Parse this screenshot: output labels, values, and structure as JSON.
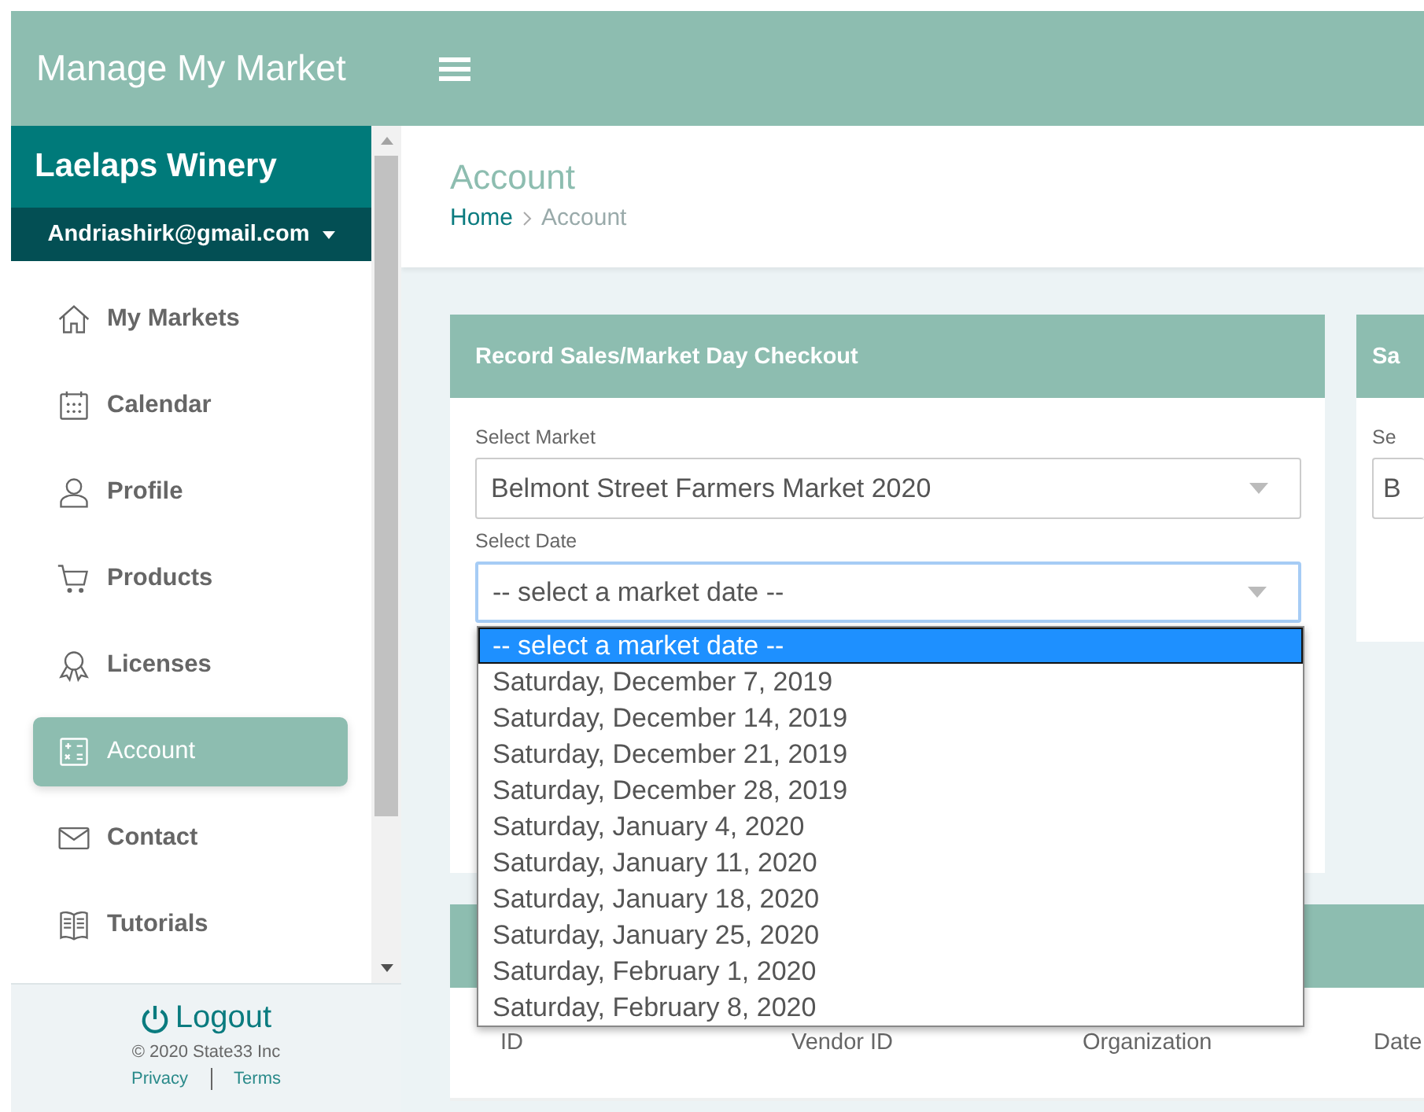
{
  "app_title": "Manage My Market",
  "sidebar": {
    "business": "Laelaps Winery",
    "user_email": "Andriashirk@gmail.com",
    "items": [
      {
        "label": "My Markets",
        "kind": "home",
        "selected": false
      },
      {
        "label": "Calendar",
        "kind": "calendar",
        "selected": false
      },
      {
        "label": "Profile",
        "kind": "person",
        "selected": false
      },
      {
        "label": "Products",
        "kind": "cart",
        "selected": false
      },
      {
        "label": "Licenses",
        "kind": "ribbon",
        "selected": false
      },
      {
        "label": "Account",
        "kind": "calculator",
        "selected": true
      },
      {
        "label": "Contact",
        "kind": "envelope",
        "selected": false
      },
      {
        "label": "Tutorials",
        "kind": "book",
        "selected": false
      }
    ],
    "logout": "Logout",
    "copyright": "© 2020 State33 Inc",
    "links": [
      "Privacy",
      "Terms"
    ]
  },
  "page": {
    "title": "Account",
    "breadcrumb": [
      "Home",
      "Account"
    ]
  },
  "checkout_card": {
    "title": "Record Sales/Market Day Checkout",
    "fields": [
      {
        "label": "Select Market",
        "value": "Belmont Street Farmers Market 2020",
        "focused": false
      },
      {
        "label": "Select Date",
        "value": "-- select a market date --",
        "focused": true
      }
    ],
    "date_options": [
      {
        "label": "-- select a market date --",
        "selected": true
      },
      {
        "label": "Saturday, December 7, 2019",
        "selected": false
      },
      {
        "label": "Saturday, December 14, 2019",
        "selected": false
      },
      {
        "label": "Saturday, December 21, 2019",
        "selected": false
      },
      {
        "label": "Saturday, December 28, 2019",
        "selected": false
      },
      {
        "label": "Saturday, January 4, 2020",
        "selected": false
      },
      {
        "label": "Saturday, January 11, 2020",
        "selected": false
      },
      {
        "label": "Saturday, January 18, 2020",
        "selected": false
      },
      {
        "label": "Saturday, January 25, 2020",
        "selected": false
      },
      {
        "label": "Saturday, February 1, 2020",
        "selected": false
      },
      {
        "label": "Saturday, February 8, 2020",
        "selected": false
      }
    ]
  },
  "second_card": {
    "title": "Sa",
    "field_label": "Se",
    "field_value": "B"
  },
  "table": {
    "columns": [
      "ID",
      "Vendor ID",
      "Organization",
      "Date"
    ]
  }
}
